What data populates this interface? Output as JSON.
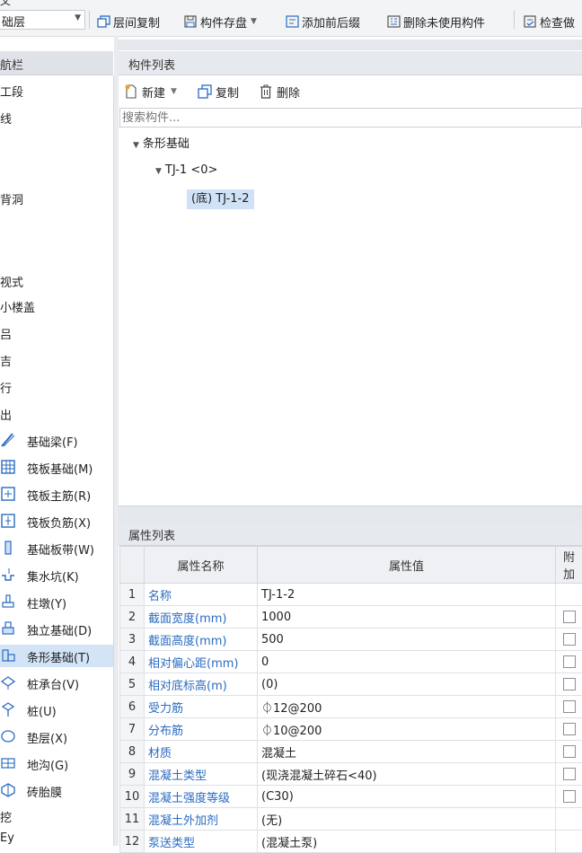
{
  "toolbar": {
    "menu_remnant": "文",
    "floor_select": "础层",
    "buttons": {
      "copy_floor": "层间复制",
      "save_component": "构件存盘",
      "add_prefix": "添加前后缀",
      "delete_unused": "删除未使用构件",
      "check": "检查做"
    }
  },
  "nav": {
    "header": "航栏",
    "fragments": [
      "工段",
      "线",
      "背洞",
      "视式",
      "小楼盖",
      "吕",
      "吉",
      "行",
      "出",
      "挖",
      "Ey"
    ],
    "items": [
      {
        "label": "基础梁(F)",
        "icon": "foundation-beam-icon"
      },
      {
        "label": "筏板基础(M)",
        "icon": "raft-foundation-icon"
      },
      {
        "label": "筏板主筋(R)",
        "icon": "raft-main-rebar-icon"
      },
      {
        "label": "筏板负筋(X)",
        "icon": "raft-negative-rebar-icon"
      },
      {
        "label": "基础板带(W)",
        "icon": "foundation-strip-icon"
      },
      {
        "label": "集水坑(K)",
        "icon": "sump-pit-icon"
      },
      {
        "label": "柱墩(Y)",
        "icon": "column-pier-icon"
      },
      {
        "label": "独立基础(D)",
        "icon": "isolated-foundation-icon"
      },
      {
        "label": "条形基础(T)",
        "icon": "strip-foundation-icon"
      },
      {
        "label": "桩承台(V)",
        "icon": "pile-cap-icon"
      },
      {
        "label": "桩(U)",
        "icon": "pile-icon"
      },
      {
        "label": "垫层(X)",
        "icon": "cushion-layer-icon"
      },
      {
        "label": "地沟(G)",
        "icon": "trench-icon"
      },
      {
        "label": "砖胎膜",
        "icon": "brick-form-icon"
      }
    ],
    "selected": "条形基础(T)"
  },
  "component_list": {
    "title": "构件列表",
    "new_label": "新建",
    "copy_label": "复制",
    "delete_label": "删除",
    "search_placeholder": "搜索构件...",
    "tree": {
      "root": "条形基础",
      "child": "TJ-1 <0>",
      "grandchild": "(底) TJ-1-2"
    }
  },
  "property_list": {
    "title": "属性列表",
    "columns": [
      "属性名称",
      "属性值",
      "附加"
    ],
    "rows": [
      {
        "num": "1",
        "name": "名称",
        "value": "TJ-1-2",
        "has_checkbox": false
      },
      {
        "num": "2",
        "name": "截面宽度(mm)",
        "value": "1000",
        "has_checkbox": true
      },
      {
        "num": "3",
        "name": "截面高度(mm)",
        "value": "500",
        "has_checkbox": true
      },
      {
        "num": "4",
        "name": "相对偏心距(mm)",
        "value": "0",
        "has_checkbox": true
      },
      {
        "num": "5",
        "name": "相对底标高(m)",
        "value": "(0)",
        "has_checkbox": true
      },
      {
        "num": "6",
        "name": "受力筋",
        "value": "⏀12@200",
        "has_checkbox": true
      },
      {
        "num": "7",
        "name": "分布筋",
        "value": "⏀10@200",
        "has_checkbox": true
      },
      {
        "num": "8",
        "name": "材质",
        "value": "混凝土",
        "has_checkbox": true
      },
      {
        "num": "9",
        "name": "混凝土类型",
        "value": "(现浇混凝土碎石<40)",
        "has_checkbox": true
      },
      {
        "num": "10",
        "name": "混凝土强度等级",
        "value": "(C30)",
        "has_checkbox": true
      },
      {
        "num": "11",
        "name": "混凝土外加剂",
        "value": "(无)",
        "has_checkbox": false
      },
      {
        "num": "12",
        "name": "泵送类型",
        "value": "(混凝土泵)",
        "has_checkbox": false
      }
    ]
  },
  "colors": {
    "accent_blue": "#2a6bc1",
    "selection": "#d3e4f7",
    "panel_header": "#e6e9ed"
  }
}
